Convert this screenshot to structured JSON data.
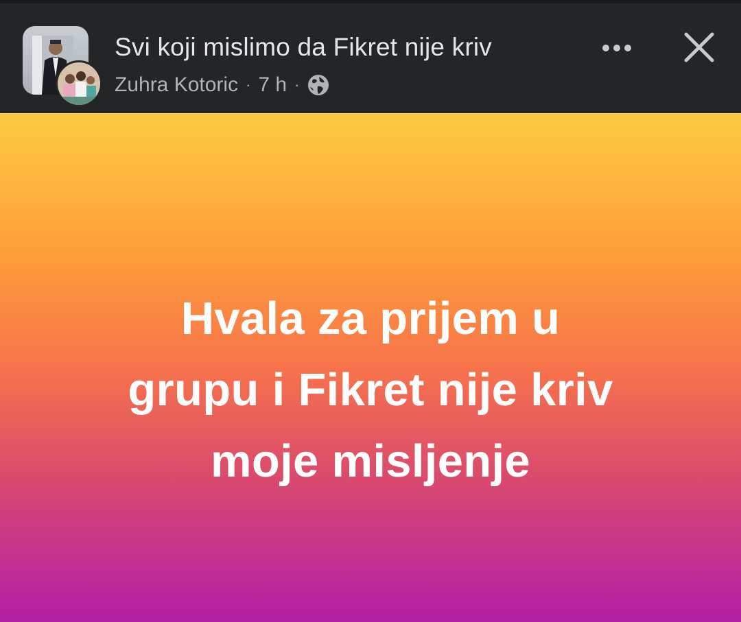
{
  "post": {
    "title": "Svi koji mislimo da Fikret nije kriv",
    "author": "Zuhra Kotoric",
    "separator": "·",
    "time": "7 h",
    "audience_icon": "globe-icon",
    "text_lines": [
      "Hvala za prijem u",
      "grupu i Fikret nije kriv",
      "moje misljenje"
    ],
    "background_gradient": [
      "#fdca41",
      "#fd9d39",
      "#f7734b",
      "#d9496e",
      "#b11fa6"
    ]
  },
  "header": {
    "more_icon": "more-dots-icon",
    "close_icon": "close-icon",
    "background": "#242526",
    "title_color": "#e4e6eb",
    "meta_color": "#b0b3b8"
  }
}
